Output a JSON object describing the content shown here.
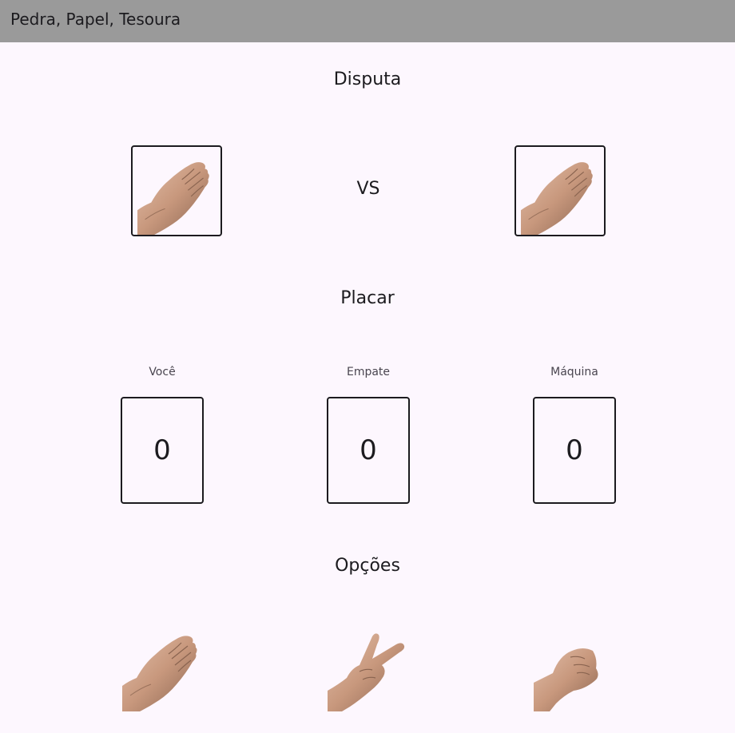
{
  "app_bar": {
    "title": "Pedra, Papel, Tesoura"
  },
  "dispute": {
    "title": "Disputa",
    "player_choice_icon": "paper-hand-icon",
    "vs_label": "VS",
    "machine_choice_icon": "paper-hand-icon"
  },
  "scoreboard": {
    "title": "Placar",
    "player": {
      "label": "Você",
      "value": "0"
    },
    "draw": {
      "label": "Empate",
      "value": "0"
    },
    "machine": {
      "label": "Máquina",
      "value": "0"
    }
  },
  "options": {
    "title": "Opções",
    "items": [
      {
        "icon": "paper-hand-icon"
      },
      {
        "icon": "scissors-hand-icon"
      },
      {
        "icon": "rock-hand-icon"
      }
    ]
  },
  "colors": {
    "app_bar": "#9a9a9a",
    "background": "#fdf7fe",
    "skin": "#c99a80",
    "text": "#1c1b1f"
  }
}
